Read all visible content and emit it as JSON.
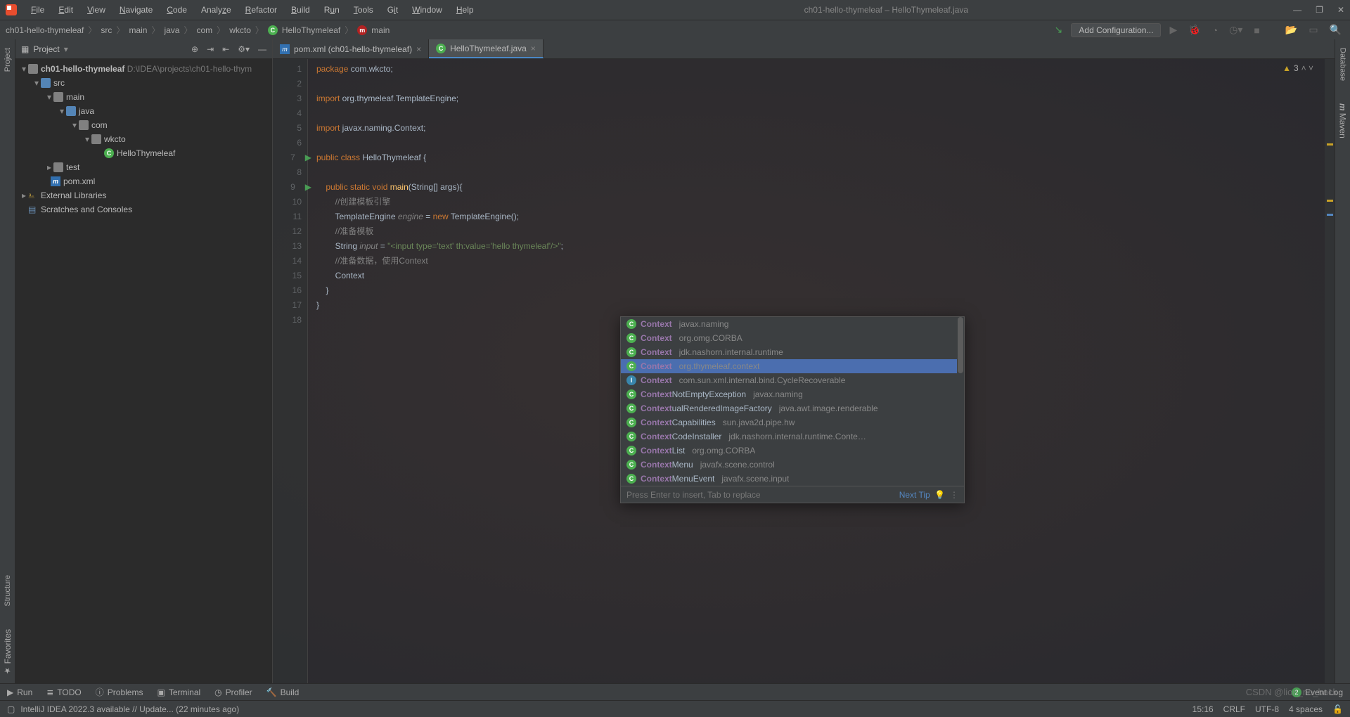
{
  "title": "ch01-hello-thymeleaf – HelloThymeleaf.java",
  "menu": [
    "File",
    "Edit",
    "View",
    "Navigate",
    "Code",
    "Analyze",
    "Refactor",
    "Build",
    "Run",
    "Tools",
    "Git",
    "Window",
    "Help"
  ],
  "breadcrumb": {
    "items": [
      "ch01-hello-thymeleaf",
      "src",
      "main",
      "java",
      "com",
      "wkcto"
    ],
    "class_item": "HelloThymeleaf",
    "method_item": "main"
  },
  "run_config": {
    "add_label": "Add Configuration..."
  },
  "project": {
    "header": "Project",
    "root": {
      "name": "ch01-hello-thymeleaf",
      "path": "D:\\IDEA\\projects\\ch01-hello-thym"
    },
    "tree": {
      "src": "src",
      "main": "main",
      "java": "java",
      "com": "com",
      "wkcto": "wkcto",
      "hello": "HelloThymeleaf",
      "test": "test",
      "pom": "pom.xml",
      "ext": "External Libraries",
      "scratch": "Scratches and Consoles"
    }
  },
  "tabs": [
    {
      "icon": "m",
      "label": "pom.xml (ch01-hello-thymeleaf)",
      "active": false
    },
    {
      "icon": "c",
      "label": "HelloThymeleaf.java",
      "active": true
    }
  ],
  "code": {
    "lines": [
      {
        "n": 1,
        "html": "<span class='kw'>package</span> com.wkcto;"
      },
      {
        "n": 2,
        "html": ""
      },
      {
        "n": 3,
        "html": "<span class='kw'>import</span> org.thymeleaf.TemplateEngine;"
      },
      {
        "n": 4,
        "html": ""
      },
      {
        "n": 5,
        "html": "<span class='kw'>import</span> javax.naming.Context;"
      },
      {
        "n": 6,
        "html": ""
      },
      {
        "n": 7,
        "html": "<span class='kw'>public class</span> <span class='cls'>HelloThymeleaf</span> {",
        "run": true
      },
      {
        "n": 8,
        "html": ""
      },
      {
        "n": 9,
        "html": "    <span class='kw'>public static void</span> <span class='fn'>main</span>(String[] <span class='param'>args</span>){",
        "run": true
      },
      {
        "n": 10,
        "html": "        <span class='cmt'>//创建模板引擎</span>"
      },
      {
        "n": 11,
        "html": "        TemplateEngine <span class='ann'>engine</span> = <span class='kw'>new</span> TemplateEngine();"
      },
      {
        "n": 12,
        "html": "        <span class='cmt'>//准备模板</span>"
      },
      {
        "n": 13,
        "html": "        String <span class='ann'>input</span> = <span class='str'>\"&lt;input type='text' th:value='hello thymeleaf'/&gt;\"</span>;"
      },
      {
        "n": 14,
        "html": "        <span class='cmt'>//准备数据，使用Context</span>"
      },
      {
        "n": 15,
        "html": "        Context"
      },
      {
        "n": 16,
        "html": "    }"
      },
      {
        "n": 17,
        "html": "}"
      },
      {
        "n": 18,
        "html": ""
      }
    ]
  },
  "warnings": {
    "count": "3"
  },
  "completion": {
    "items": [
      {
        "ic": "c",
        "name": "Context",
        "suffix": "",
        "pkg": "javax.naming"
      },
      {
        "ic": "c",
        "name": "Context",
        "suffix": "",
        "pkg": "org.omg.CORBA"
      },
      {
        "ic": "c",
        "name": "Context",
        "suffix": "",
        "pkg": "jdk.nashorn.internal.runtime"
      },
      {
        "ic": "c",
        "name": "Context",
        "suffix": "",
        "pkg": "org.thymeleaf.context",
        "sel": true
      },
      {
        "ic": "i",
        "name": "Context",
        "suffix": "",
        "pkg": "com.sun.xml.internal.bind.CycleRecoverable"
      },
      {
        "ic": "c",
        "name": "Context",
        "suffix": "NotEmptyException",
        "pkg": "javax.naming"
      },
      {
        "ic": "c",
        "name": "Context",
        "suffix": "ualRenderedImageFactory",
        "pkg": "java.awt.image.renderable"
      },
      {
        "ic": "c",
        "name": "Context",
        "suffix": "Capabilities",
        "pkg": "sun.java2d.pipe.hw"
      },
      {
        "ic": "c",
        "name": "Context",
        "suffix": "CodeInstaller",
        "pkg": "jdk.nashorn.internal.runtime.Conte…"
      },
      {
        "ic": "c",
        "name": "Context",
        "suffix": "List",
        "pkg": "org.omg.CORBA"
      },
      {
        "ic": "c",
        "name": "Context",
        "suffix": "Menu",
        "pkg": "javafx.scene.control"
      },
      {
        "ic": "c",
        "name": "Context",
        "suffix": "MenuEvent",
        "pkg": "javafx.scene.input"
      }
    ],
    "hint": "Press Enter to insert, Tab to replace",
    "next": "Next Tip"
  },
  "left_tools": {
    "project": "Project",
    "structure": "Structure",
    "favorites": "Favorites"
  },
  "right_tools": {
    "database": "Database",
    "maven": "Maven"
  },
  "bottom": {
    "run": "Run",
    "todo": "TODO",
    "problems": "Problems",
    "terminal": "Terminal",
    "profiler": "Profiler",
    "build": "Build",
    "event": "Event Log"
  },
  "status": {
    "msg": "IntelliJ IDEA 2022.3 available // Update... (22 minutes ago)",
    "pos": "15:16",
    "sep": "CRLF",
    "enc": "UTF-8",
    "indent": "4 spaces"
  },
  "watermark": "CSDN @lion_no_back"
}
